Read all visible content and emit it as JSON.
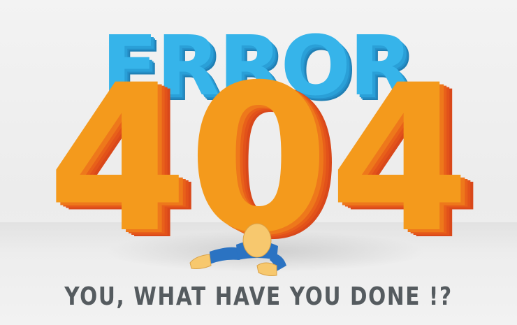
{
  "headline": {
    "word": "ERROR",
    "code": "404"
  },
  "tagline": "YOU, WHAT HAVE YOU DONE !?",
  "colors": {
    "error_front": "#36b4ea",
    "error_side": "#1f7fb4",
    "code_front": "#f49a1c",
    "code_side": "#e8561a",
    "tagline_text": "#555b5f",
    "figure_skin": "#f7c86e",
    "figure_shirt": "#2b73c2"
  },
  "icons": {
    "figure": "stuck-person-illustration"
  }
}
